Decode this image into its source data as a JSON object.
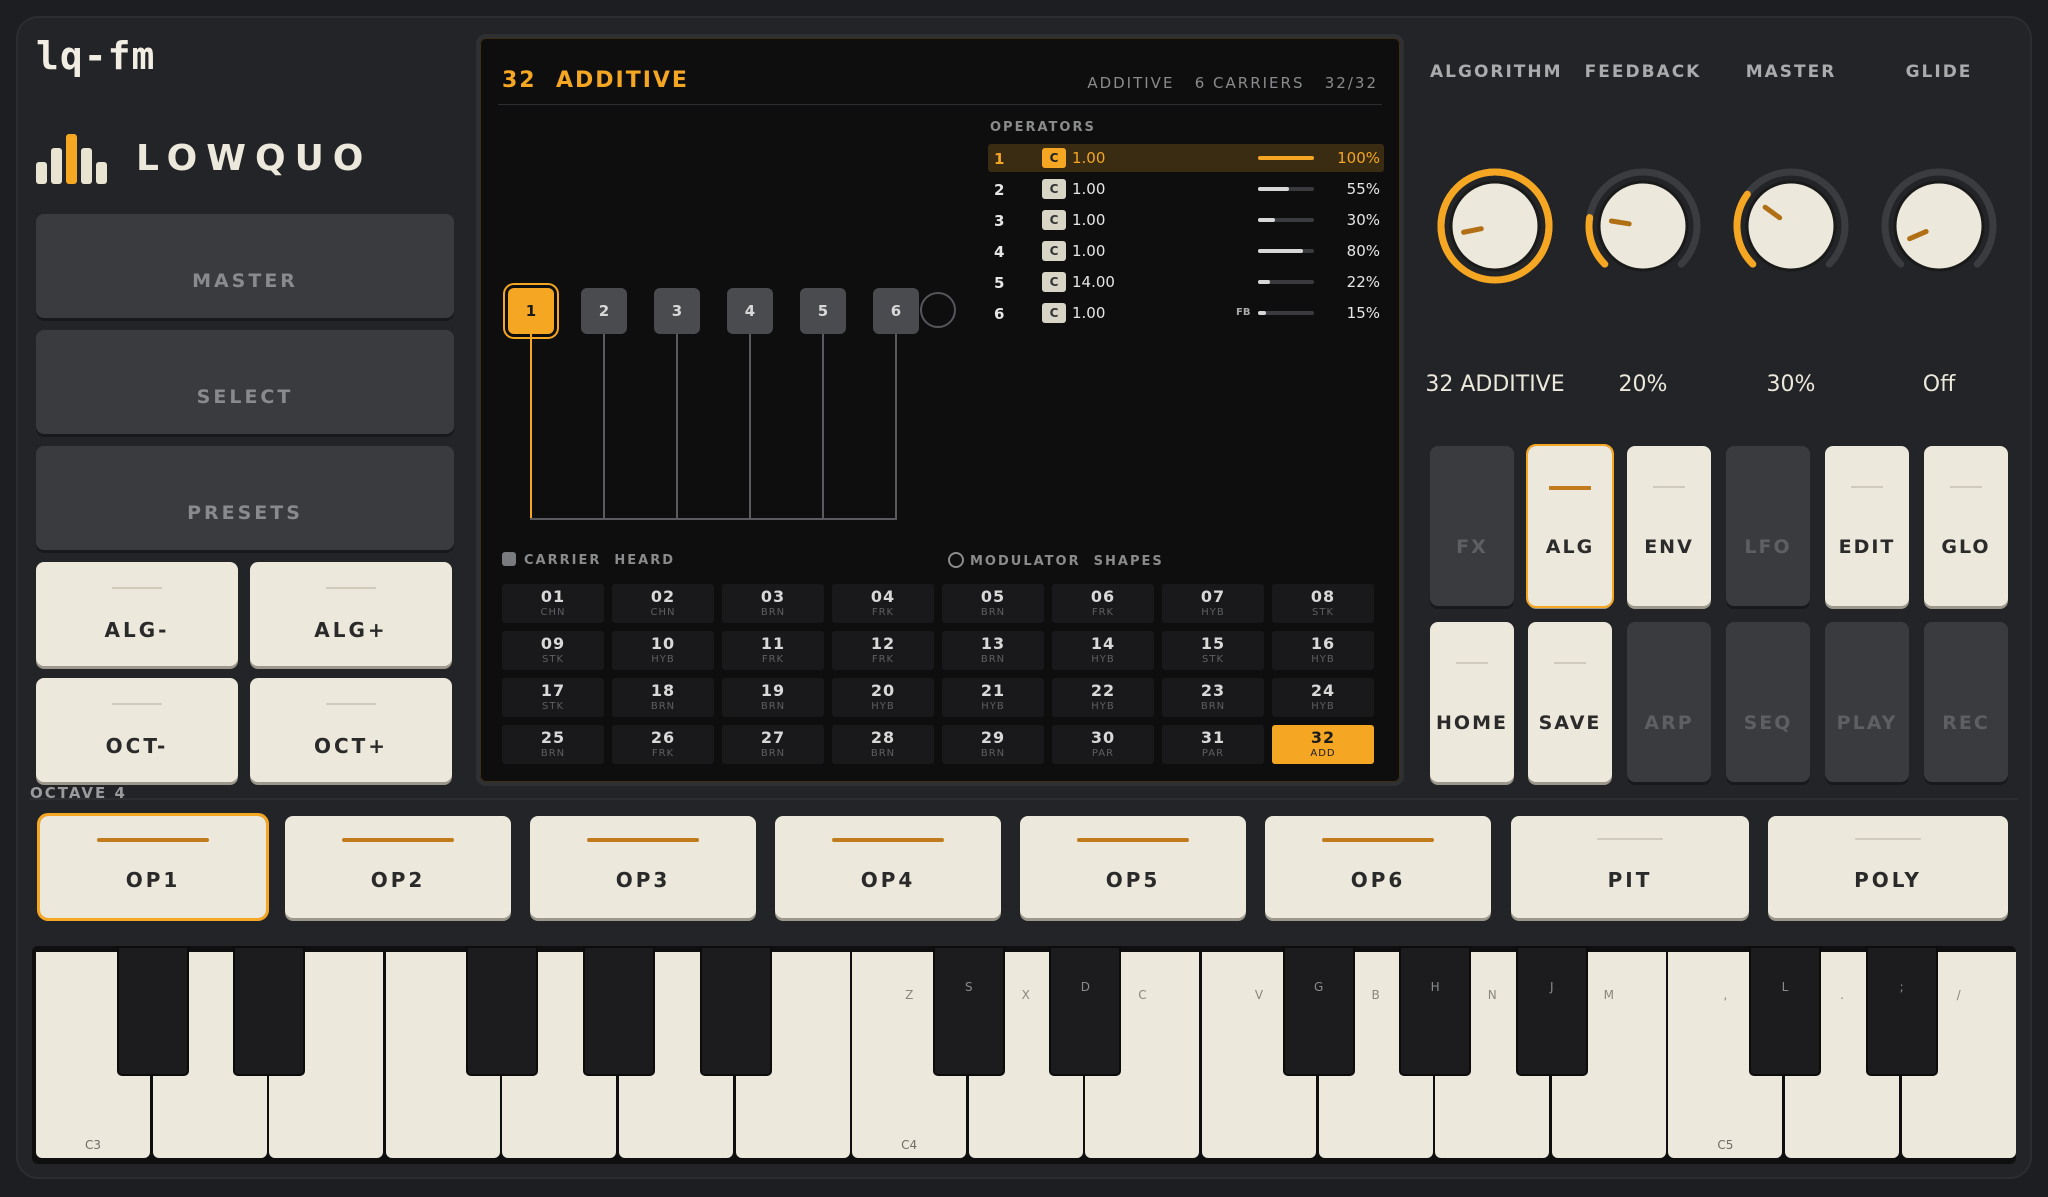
{
  "app": {
    "title": "lq-fm",
    "brand": "LOWQUO"
  },
  "left_nav": [
    {
      "id": "master",
      "label": "MASTER"
    },
    {
      "id": "select",
      "label": "SELECT"
    },
    {
      "id": "presets",
      "label": "PRESETS"
    }
  ],
  "left_keys": {
    "alg_minus": "ALG-",
    "alg_plus": "ALG+",
    "oct_minus": "OCT-",
    "oct_plus": "OCT+"
  },
  "octave_label": "OCTAVE 4",
  "display": {
    "title_num": "32",
    "title_name": "ADDITIVE",
    "meta": "ADDITIVE   6 CARRIERS   32/32",
    "operators_heading": "OPERATORS",
    "op_boxes": [
      "1",
      "2",
      "3",
      "4",
      "5",
      "6"
    ],
    "operators": [
      {
        "num": "1",
        "type": "C",
        "ratio": "1.00",
        "level": "100%",
        "level_frac": 1.0,
        "fb": ""
      },
      {
        "num": "2",
        "type": "C",
        "ratio": "1.00",
        "level": "55%",
        "level_frac": 0.55,
        "fb": ""
      },
      {
        "num": "3",
        "type": "C",
        "ratio": "1.00",
        "level": "30%",
        "level_frac": 0.3,
        "fb": ""
      },
      {
        "num": "4",
        "type": "C",
        "ratio": "1.00",
        "level": "80%",
        "level_frac": 0.8,
        "fb": ""
      },
      {
        "num": "5",
        "type": "C",
        "ratio": "14.00",
        "level": "22%",
        "level_frac": 0.22,
        "fb": ""
      },
      {
        "num": "6",
        "type": "C",
        "ratio": "1.00",
        "level": "15%",
        "level_frac": 0.15,
        "fb": "FB"
      }
    ],
    "legend_carrier": "CARRIER  HEARD",
    "legend_modulator": "MODULATOR  SHAPES",
    "algorithms": [
      {
        "n": "01",
        "t": "CHN"
      },
      {
        "n": "02",
        "t": "CHN"
      },
      {
        "n": "03",
        "t": "BRN"
      },
      {
        "n": "04",
        "t": "FRK"
      },
      {
        "n": "05",
        "t": "BRN"
      },
      {
        "n": "06",
        "t": "FRK"
      },
      {
        "n": "07",
        "t": "HYB"
      },
      {
        "n": "08",
        "t": "STK"
      },
      {
        "n": "09",
        "t": "STK"
      },
      {
        "n": "10",
        "t": "HYB"
      },
      {
        "n": "11",
        "t": "FRK"
      },
      {
        "n": "12",
        "t": "FRK"
      },
      {
        "n": "13",
        "t": "BRN"
      },
      {
        "n": "14",
        "t": "HYB"
      },
      {
        "n": "15",
        "t": "STK"
      },
      {
        "n": "16",
        "t": "HYB"
      },
      {
        "n": "17",
        "t": "STK"
      },
      {
        "n": "18",
        "t": "BRN"
      },
      {
        "n": "19",
        "t": "BRN"
      },
      {
        "n": "20",
        "t": "HYB"
      },
      {
        "n": "21",
        "t": "HYB"
      },
      {
        "n": "22",
        "t": "HYB"
      },
      {
        "n": "23",
        "t": "BRN"
      },
      {
        "n": "24",
        "t": "HYB"
      },
      {
        "n": "25",
        "t": "BRN"
      },
      {
        "n": "26",
        "t": "FRK"
      },
      {
        "n": "27",
        "t": "BRN"
      },
      {
        "n": "28",
        "t": "BRN"
      },
      {
        "n": "29",
        "t": "BRN"
      },
      {
        "n": "30",
        "t": "PAR"
      },
      {
        "n": "31",
        "t": "PAR"
      },
      {
        "n": "32",
        "t": "ADD"
      }
    ],
    "selected_algorithm": "32"
  },
  "knobs": [
    {
      "label": "ALGORITHM",
      "value": "32 ADDITIVE",
      "level": 1.0
    },
    {
      "label": "FEEDBACK",
      "value": "20%",
      "level": 0.2
    },
    {
      "label": "MASTER",
      "value": "30%",
      "level": 0.3
    },
    {
      "label": "GLIDE",
      "value": "Off",
      "level": 0.0
    }
  ],
  "right_buttons_row1": [
    {
      "label": "FX",
      "style": "dark"
    },
    {
      "label": "ALG",
      "style": "active"
    },
    {
      "label": "ENV",
      "style": "light"
    },
    {
      "label": "LFO",
      "style": "dark"
    },
    {
      "label": "EDIT",
      "style": "light"
    },
    {
      "label": "GLO",
      "style": "light"
    }
  ],
  "right_buttons_row2": [
    {
      "label": "HOME",
      "style": "light"
    },
    {
      "label": "SAVE",
      "style": "light"
    },
    {
      "label": "ARP",
      "style": "dark"
    },
    {
      "label": "SEQ",
      "style": "dark"
    },
    {
      "label": "PLAY",
      "style": "dark"
    },
    {
      "label": "REC",
      "style": "dark"
    }
  ],
  "op_buttons": [
    {
      "label": "OP1",
      "on": true,
      "active": true
    },
    {
      "label": "OP2",
      "on": true,
      "active": false
    },
    {
      "label": "OP3",
      "on": true,
      "active": false
    },
    {
      "label": "OP4",
      "on": true,
      "active": false
    },
    {
      "label": "OP5",
      "on": true,
      "active": false
    },
    {
      "label": "OP6",
      "on": true,
      "active": false
    },
    {
      "label": "PIT",
      "on": false,
      "active": false
    },
    {
      "label": "POLY",
      "on": false,
      "active": false
    }
  ],
  "keyboard": {
    "white_labels": {
      "0": "C3",
      "7": "C4",
      "14": "C5"
    },
    "white_shortcuts": {
      "7": "Z",
      "8": "X",
      "9": "C",
      "10": "V",
      "11": "B",
      "12": "N",
      "13": "M",
      "14": ",",
      "15": ".",
      "16": "/"
    },
    "black_shortcuts": {
      "5": "S",
      "6": "D",
      "7": "G",
      "8": "H",
      "9": "J",
      "10": "L",
      "11": ";"
    }
  },
  "colors": {
    "accent": "#f5a623",
    "panel": "#222427",
    "key_light": "#ece8db",
    "key_dark": "#3a3b3f"
  }
}
